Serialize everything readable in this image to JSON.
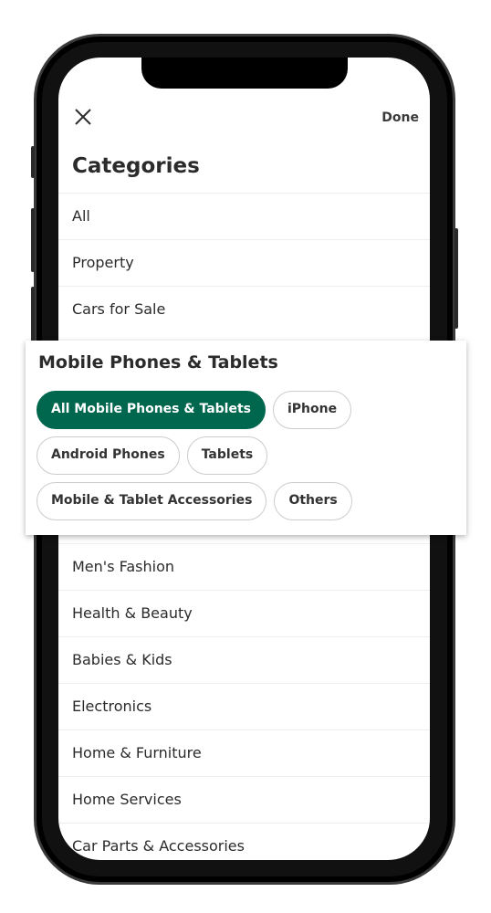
{
  "header": {
    "close_icon": "close-icon",
    "done_label": "Done",
    "title": "Categories"
  },
  "categories_top": [
    "All",
    "Property",
    "Cars for Sale"
  ],
  "categories_bottom": [
    "Men's Fashion",
    "Health & Beauty",
    "Babies & Kids",
    "Electronics",
    "Home & Furniture",
    "Home Services",
    "Car Parts & Accessories"
  ],
  "subcategory_card": {
    "title": "Mobile Phones & Tablets",
    "chips": [
      {
        "label": "All Mobile Phones & Tablets",
        "selected": true
      },
      {
        "label": "iPhone",
        "selected": false
      },
      {
        "label": "Android Phones",
        "selected": false
      },
      {
        "label": "Tablets",
        "selected": false
      },
      {
        "label": "Mobile & Tablet Accessories",
        "selected": false
      },
      {
        "label": "Others",
        "selected": false
      }
    ]
  },
  "colors": {
    "accent": "#00674f"
  }
}
